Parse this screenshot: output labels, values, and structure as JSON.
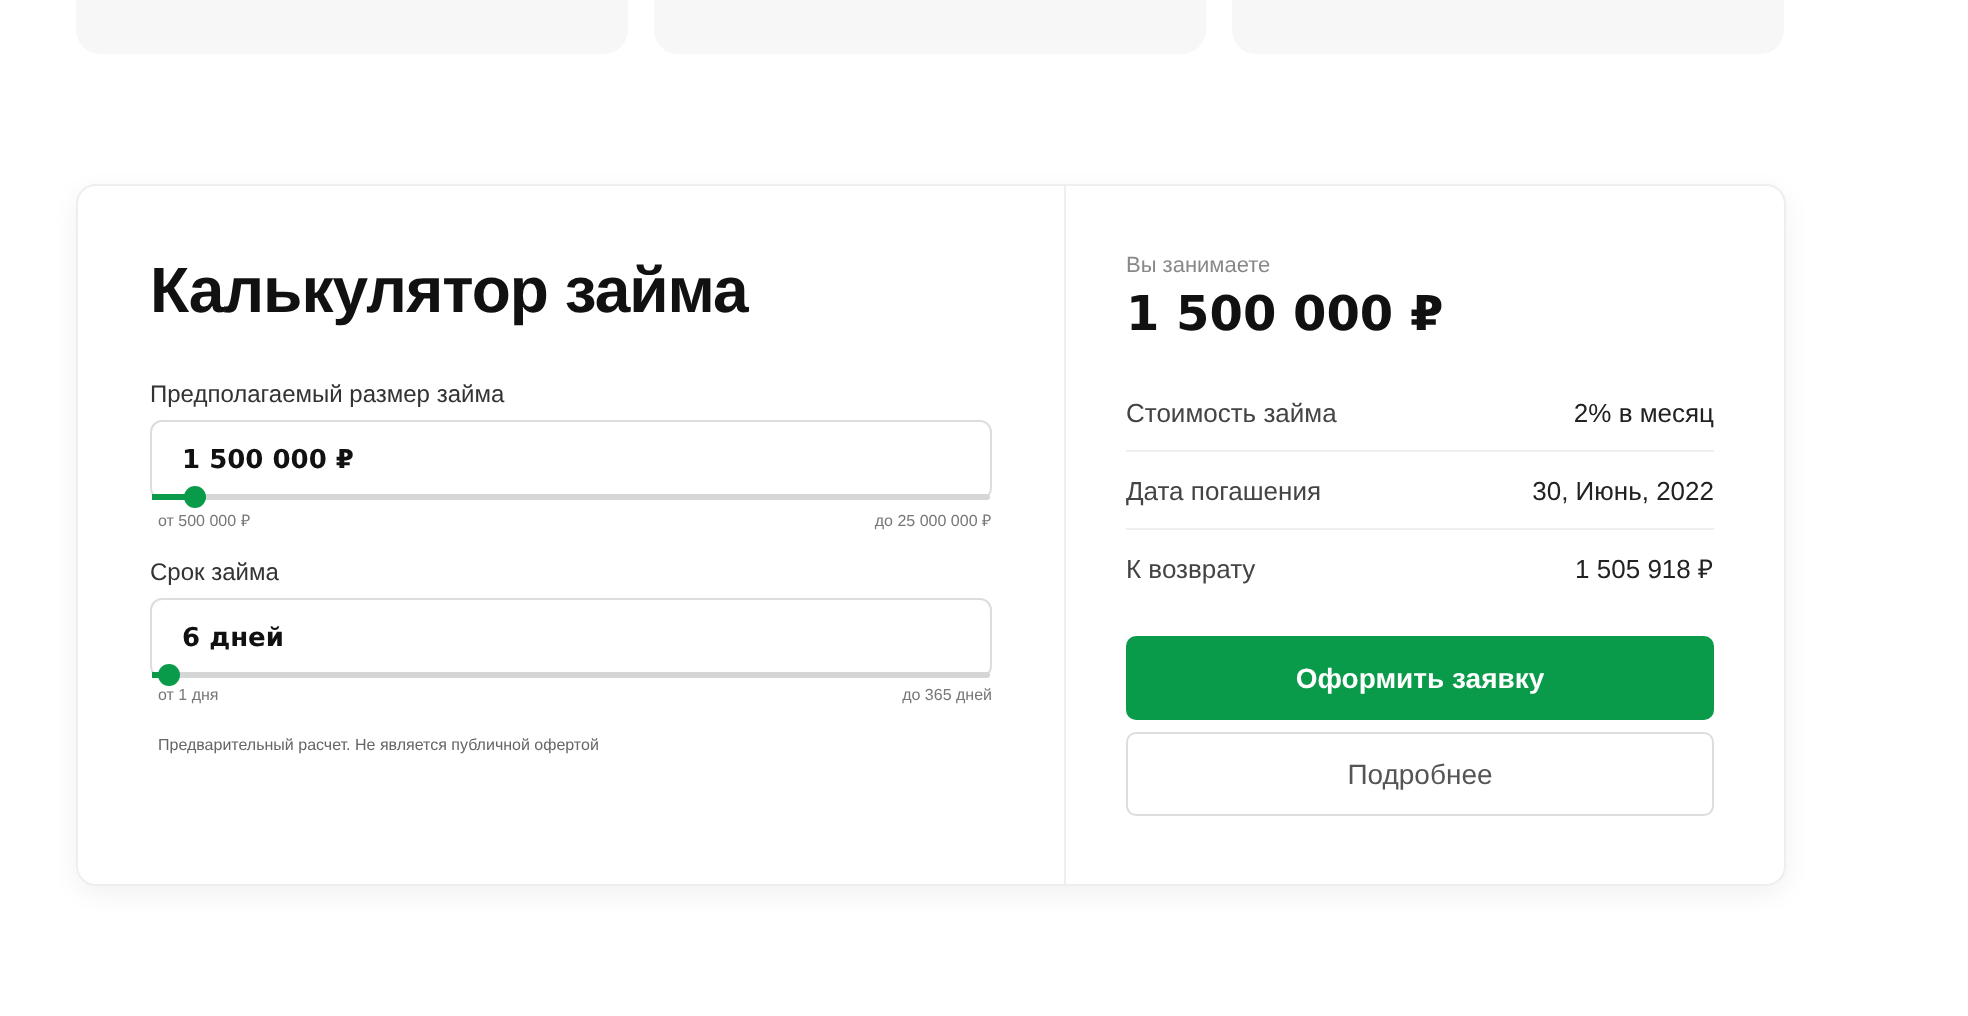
{
  "top_cards": [
    {
      "kind": "card"
    },
    {
      "kind": "card"
    },
    {
      "kind": "card"
    }
  ],
  "calculator": {
    "title": "Калькулятор займа",
    "sliders": [
      {
        "label": "Предполагаемый размер займа",
        "value": "1 500 000 ₽",
        "level": 0.04,
        "min": "от 500 000 ₽",
        "max": "до 25 000 000 ₽"
      },
      {
        "label": "Срок займа",
        "value": "6 дней",
        "level": 0.01,
        "min": "от 1 дня",
        "max": "до 365 дней"
      }
    ],
    "note": "Предварительный расчет. Не является публичной офертой"
  },
  "summary": {
    "caption": "Вы занимаете",
    "amount": "1 500 000 ₽",
    "rows": [
      {
        "label": "Стоимость займа",
        "value": "2% в месяц"
      },
      {
        "label": "Дата погашения",
        "value": "30, Июнь, 2022"
      },
      {
        "label": "К возврату",
        "value": "1 505 918 ₽"
      }
    ],
    "buttons": [
      {
        "label": "Оформить заявку",
        "kind": "primary"
      },
      {
        "label": "Подробнее",
        "kind": "secondary"
      }
    ]
  }
}
